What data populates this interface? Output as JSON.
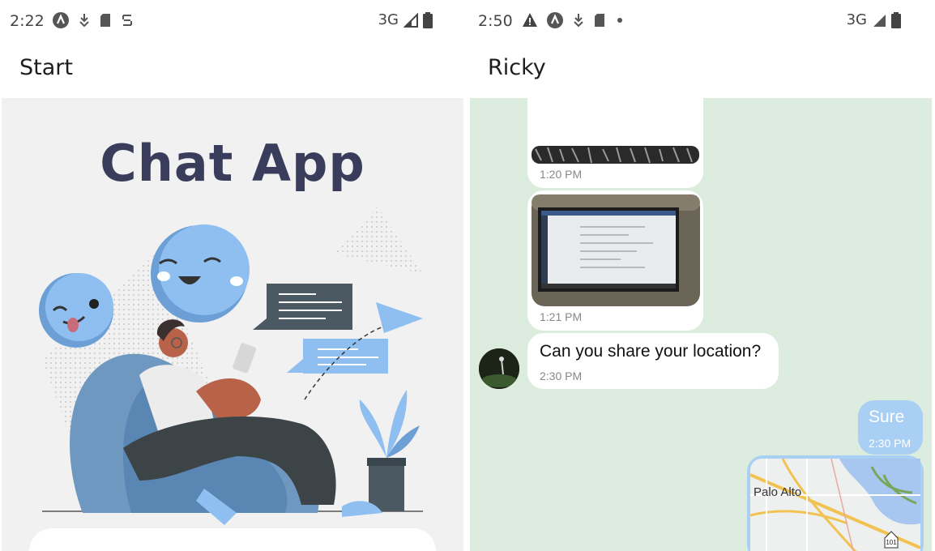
{
  "left": {
    "status": {
      "time": "2:22",
      "network": "3G"
    },
    "appbar": {
      "title": "Start"
    },
    "hero": {
      "title": "Chat App"
    }
  },
  "right": {
    "status": {
      "time": "2:50",
      "network": "3G"
    },
    "appbar": {
      "title": "Ricky"
    },
    "messages": [
      {
        "type": "image",
        "time": "1:20 PM",
        "from": "other"
      },
      {
        "type": "image",
        "time": "1:21 PM",
        "from": "other"
      },
      {
        "type": "text",
        "text": "Can you share your location?",
        "time": "2:30 PM",
        "from": "other"
      },
      {
        "type": "text",
        "text": "Sure",
        "time": "2:30 PM",
        "from": "me"
      },
      {
        "type": "map",
        "label": "Palo Alto",
        "highway": "101",
        "from": "me"
      }
    ]
  },
  "colors": {
    "chat_bg": "#dcede0",
    "my_bubble": "#a9cff5",
    "title": "#393c5a",
    "illus_blue": "#8fbff0"
  }
}
